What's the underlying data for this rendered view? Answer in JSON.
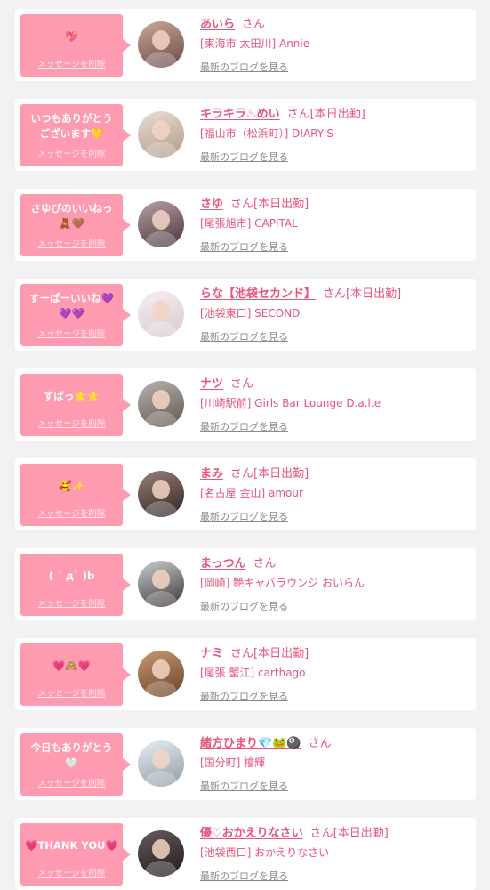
{
  "common": {
    "delete_label": "メッセージを削除",
    "blog_label": "最新のブログを見る",
    "san_label": "さん"
  },
  "entries": [
    {
      "message": "💖",
      "name": "あいら",
      "working": "",
      "shop": "[東海市 太田川] Annie",
      "avatar_colors": [
        "#c9a79a",
        "#6b4a45"
      ]
    },
    {
      "message": "いつもありがとう\nございます💛",
      "name": "キラキラ♨めい",
      "working": "[本日出勤]",
      "shop": "[福山市（松浜町）] DIARY'S",
      "avatar_colors": [
        "#e8ddd2",
        "#b09b8a"
      ]
    },
    {
      "message": "さゆぴのいいねっ\n🧸🤎",
      "name": "さゆ",
      "working": "[本日出勤]",
      "shop": "[尾張旭市] CAPITAL",
      "avatar_colors": [
        "#b8a0a6",
        "#4a3538"
      ]
    },
    {
      "message": "すーぱーいいね💜\n💜💜",
      "name": "らな【池袋セカンド】",
      "working": "[本日出勤]",
      "shop": "[池袋東口] SECOND",
      "avatar_colors": [
        "#f6f0f2",
        "#d8c8cc"
      ]
    },
    {
      "message": "すばっ⭐⭐",
      "name": "ナツ",
      "working": "",
      "shop": "[川崎駅前] Girls Bar Lounge D.a.l.e",
      "avatar_colors": [
        "#b9b3ae",
        "#5e5650"
      ]
    },
    {
      "message": "🥰✨",
      "name": "まみ",
      "working": "[本日出勤]",
      "shop": "[名古屋 金山] amour",
      "avatar_colors": [
        "#9a8078",
        "#2e2424"
      ]
    },
    {
      "message": "( ´ д` )b",
      "name": "まっつん",
      "working": "",
      "shop": "[岡崎] 艶キャバラウンジ おいらん",
      "avatar_colors": [
        "#c8d0cf",
        "#3c3438"
      ]
    },
    {
      "message": "💗🙈💗",
      "name": "ナミ",
      "working": "[本日出勤]",
      "shop": "[尾張 蟹江] carthago",
      "avatar_colors": [
        "#c89a72",
        "#6a4128"
      ]
    },
    {
      "message": "今日もありがとう\n🤍",
      "name": "緒方ひまり💎🐸🎱",
      "working": "",
      "shop": "[国分町] 檜輝",
      "avatar_colors": [
        "#e6eef4",
        "#8f9aa6"
      ]
    },
    {
      "message": "💗THANK YOU💗",
      "name": "優♡おかえりなさい",
      "working": "[本日出勤]",
      "shop": "[池袋西口] おかえりなさい",
      "avatar_colors": [
        "#6a5a5c",
        "#1e1a1c"
      ]
    }
  ]
}
